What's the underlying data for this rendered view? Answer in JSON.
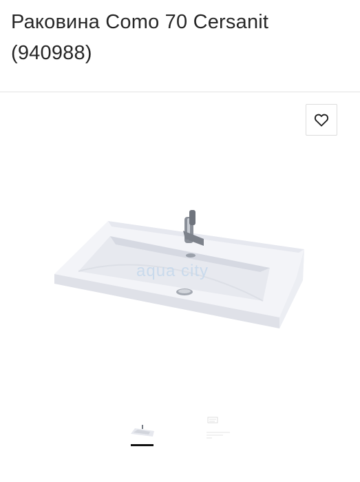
{
  "product": {
    "title": "Раковина Como 70 Cersanit (940988)"
  },
  "gallery": {
    "watermark": "aqua city",
    "active_index": 0,
    "thumbnails": [
      "sink-photo",
      "technical-drawing"
    ]
  },
  "icons": {
    "favorite": "heart-outline-icon"
  },
  "colors": {
    "accent": "#111111",
    "border": "#dcdcdc",
    "watermark": "#c4d8ec"
  }
}
